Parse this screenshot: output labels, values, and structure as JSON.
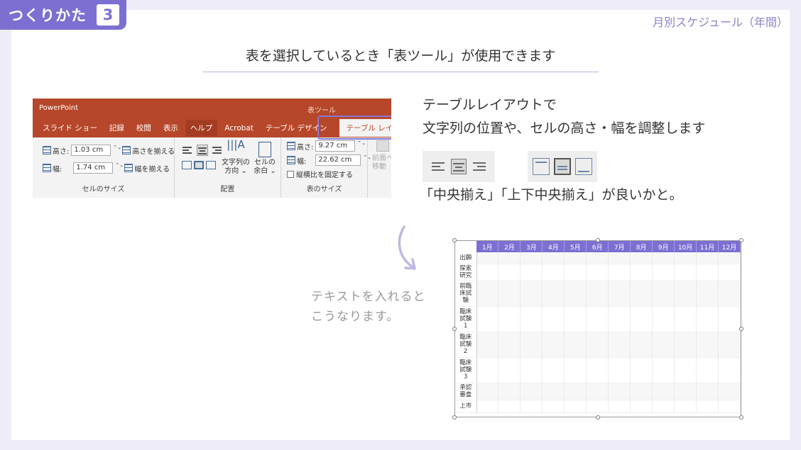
{
  "step": {
    "label": "つくりかた",
    "number": "3"
  },
  "category": "月別スケジュール（年間）",
  "headline": "表を選択しているとき「表ツール」が使用できます",
  "ribbon": {
    "app": "PowerPoint",
    "context_label": "表ツール",
    "tabs": [
      "スライド ショー",
      "記録",
      "校閲",
      "表示",
      "ヘルプ",
      "Acrobat",
      "テーブル デザイン",
      "テーブル レイアウト"
    ],
    "cell_size": {
      "height_label": "高さ:",
      "height_value": "1.03 cm",
      "width_label": "幅:",
      "width_value": "1.74 cm",
      "distribute_rows": "高さを揃える",
      "distribute_cols": "幅を揃える",
      "caption": "セルのサイズ"
    },
    "alignment": {
      "text_direction": "文字列の\n方向 ⌄",
      "margins": "セルの\n余白 ⌄",
      "caption": "配置"
    },
    "table_size": {
      "height_label": "高さ:",
      "height_value": "9.27 cm",
      "width_label": "幅:",
      "width_value": "22.62 cm",
      "lock_ratio": "縦横比を固定する",
      "caption": "表のサイズ"
    },
    "arrange": {
      "bring_forward": "前面へ\n移動"
    }
  },
  "description": {
    "line1": "テーブルレイアウトで",
    "line2": "文字列の位置や、セルの高さ・幅を調整します"
  },
  "recommendation": "「中央揃え」「上下中央揃え」が良いかと。",
  "note": {
    "line1": "テキストを入れると",
    "line2": "こうなります。"
  },
  "schedule": {
    "months": [
      "1月",
      "2月",
      "3月",
      "4月",
      "5月",
      "6月",
      "7月",
      "8月",
      "9月",
      "10月",
      "11月",
      "12月"
    ],
    "rows": [
      "出願",
      "探索\n研究",
      "前臨\n床試\n験",
      "臨床\n試験\n1",
      "臨床\n試験\n2",
      "臨床\n試験\n3",
      "承認\n審査",
      "上市"
    ]
  }
}
